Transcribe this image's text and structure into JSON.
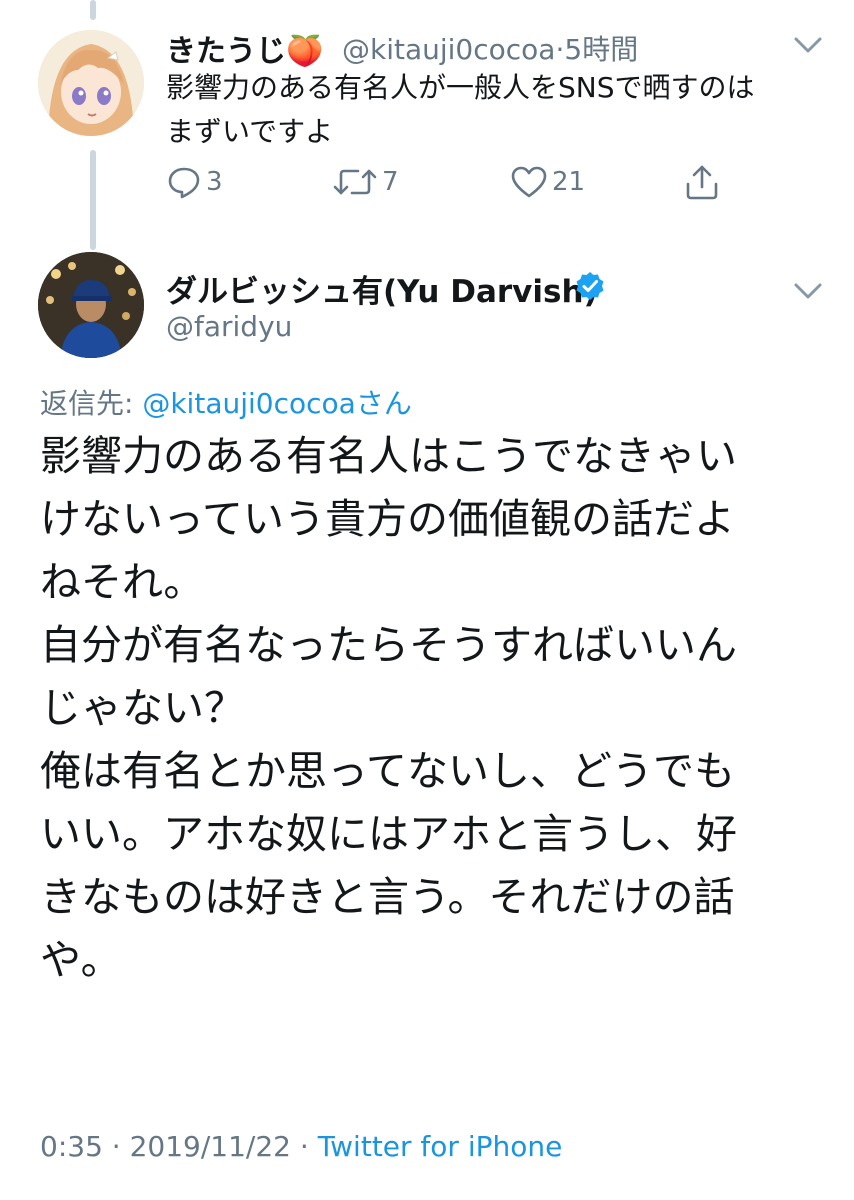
{
  "reply_tweet": {
    "display_name": "きたうじ",
    "emoji": "🍑",
    "handle": "@kitauji0cocoa",
    "time": "5時間",
    "separator": "·",
    "text_lines": [
      "影響力のある有名人が一般人をSNSで晒すのは",
      "まずいですよ"
    ],
    "actions": {
      "replies": "3",
      "retweets": "7",
      "likes": "21"
    },
    "avatar_icon": "anime-girl-avatar"
  },
  "main_tweet": {
    "display_name": "ダルビッシュ有(Yu Darvish)",
    "verified_icon": "verified-badge-icon",
    "handle": "@faridyu",
    "replying_prefix": "返信先: ",
    "replying_mention": "@kitauji0cocoa",
    "replying_suffix": "さん",
    "text_lines": [
      "影響力のある有名人はこうでなきゃい",
      "けないっていう貴方の価値観の話だよ",
      "ねそれ。",
      "自分が有名なったらそうすればいいん",
      "じゃない？",
      "俺は有名とか思ってないし、どうでも",
      "いい。アホな奴にはアホと言うし、好",
      "きなものは好きと言う。それだけの話",
      "や。"
    ],
    "time": "0:35",
    "sep1": " · ",
    "date": "2019/11/22",
    "sep2": " · ",
    "source": "Twitter for iPhone"
  },
  "colors": {
    "text": "#14171a",
    "secondary": "#657786",
    "link": "#1b95e0",
    "verified": "#1da1f2",
    "thread_line": "#ccd6dd"
  }
}
